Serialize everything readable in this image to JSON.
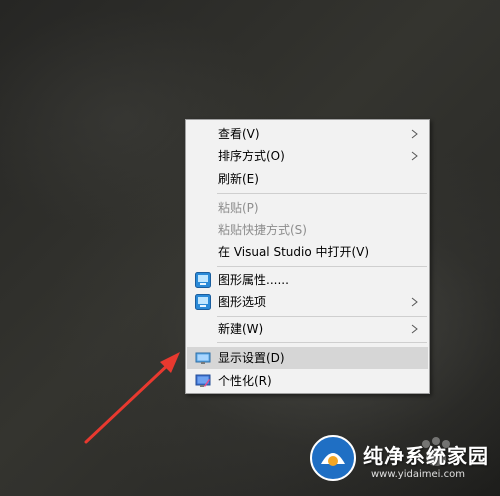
{
  "context_menu": {
    "items": [
      {
        "label": "查看(V)",
        "has_submenu": true
      },
      {
        "label": "排序方式(O)",
        "has_submenu": true
      },
      {
        "label": "刷新(E)"
      },
      {
        "label": "粘贴(P)",
        "disabled": true
      },
      {
        "label": "粘贴快捷方式(S)",
        "disabled": true
      },
      {
        "label": "在 Visual Studio 中打开(V)"
      },
      {
        "label": "图形属性......",
        "icon": "intel-graphics-icon"
      },
      {
        "label": "图形选项",
        "icon": "intel-graphics-icon",
        "has_submenu": true
      },
      {
        "label": "新建(W)",
        "has_submenu": true
      },
      {
        "label": "显示设置(D)",
        "icon": "display-settings-icon",
        "highlighted": true
      },
      {
        "label": "个性化(R)",
        "icon": "personalize-icon"
      }
    ]
  },
  "watermark": {
    "title": "纯净系统家园",
    "url": "www.yidaimei.com"
  },
  "colors": {
    "menu_bg": "#f2f2f2",
    "highlight": "#d6d6d6",
    "disabled_text": "#8d8d8d",
    "annotation_arrow": "#e8392f"
  }
}
